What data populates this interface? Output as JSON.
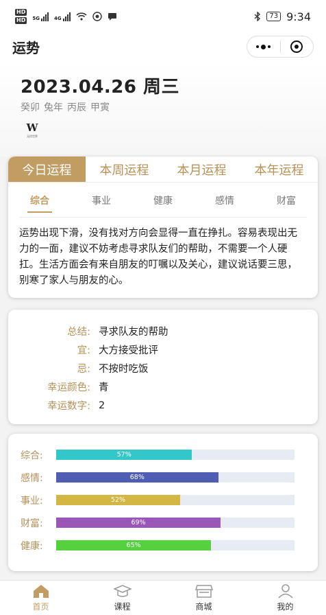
{
  "status_bar": {
    "hd1": "HD",
    "hd2": "HD",
    "net1": "5G",
    "net2": "4G",
    "battery": "73",
    "time": "9:34"
  },
  "nav": {
    "title": "运势"
  },
  "date": {
    "title": "2023.04.26 周三",
    "ganzhi": [
      "癸卯",
      "兔年",
      "丙辰",
      "甲寅"
    ]
  },
  "logo": {
    "mark": "W",
    "text": "无忧世界"
  },
  "period_tabs": [
    "今日运程",
    "本周运程",
    "本月运程",
    "本年运程"
  ],
  "sub_tabs": [
    "综合",
    "事业",
    "健康",
    "感情",
    "财富"
  ],
  "fortune_text": "运势出现下滑，没有找对方向会显得一直在挣扎。容易表现出无力的一面，建议不妨考虑寻求队友们的帮助，不需要一个人硬扛。生活方面会有来自朋友的叮嘱以及关心，建议说话要三思，别寒了家人与朋友的心。",
  "summary": [
    {
      "label": "总结:",
      "value": "寻求队友的帮助"
    },
    {
      "label": "宜:",
      "value": "大方接受批评"
    },
    {
      "label": "忌:",
      "value": "不按时吃饭"
    },
    {
      "label": "幸运颜色:",
      "value": "青"
    },
    {
      "label": "幸运数字:",
      "value": "2"
    }
  ],
  "scores": [
    {
      "label": "综合:",
      "percent_text": "57%",
      "value": 57,
      "color": "#34c7c9"
    },
    {
      "label": "感情:",
      "percent_text": "68%",
      "value": 68,
      "color": "#4f5db3"
    },
    {
      "label": "事业:",
      "percent_text": "52%",
      "value": 52,
      "color": "#d4b642"
    },
    {
      "label": "财富:",
      "percent_text": "69%",
      "value": 69,
      "color": "#9a57b8"
    },
    {
      "label": "健康:",
      "percent_text": "65%",
      "value": 65,
      "color": "#55d03f"
    }
  ],
  "tabbar": [
    {
      "label": "首页",
      "icon": "home-icon"
    },
    {
      "label": "课程",
      "icon": "graduation-cap-icon"
    },
    {
      "label": "商城",
      "icon": "store-icon"
    },
    {
      "label": "我的",
      "icon": "user-icon"
    }
  ]
}
